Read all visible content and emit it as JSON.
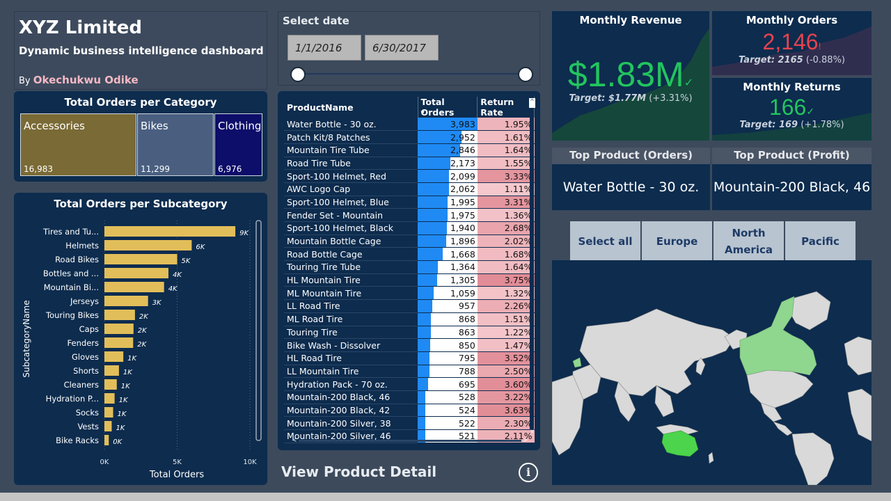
{
  "header": {
    "title": "XYZ Limited",
    "subtitle": "Dynamic business intelligence dashboard",
    "by_label": "By",
    "author": "Okechukwu Odike"
  },
  "date_slicer": {
    "label": "Select date",
    "start": "1/1/2016",
    "end": "6/30/2017"
  },
  "category_panel": {
    "title": "Total Orders per Category",
    "tiles": [
      {
        "name": "Accessories",
        "value": "16,983",
        "color": "#7a6a35"
      },
      {
        "name": "Bikes",
        "value": "11,299",
        "color": "#4a5f80"
      },
      {
        "name": "Clothing",
        "value": "6,976",
        "color": "#0d0d6a"
      }
    ]
  },
  "chart_data": {
    "type": "bar",
    "title": "Total Orders per Subcategory",
    "xlabel": "Total Orders",
    "ylabel": "SubcategoryName",
    "xlim": [
      0,
      10000
    ],
    "xticks": [
      "0K",
      "5K",
      "10K"
    ],
    "categories": [
      "Tires and Tu...",
      "Helmets",
      "Road Bikes",
      "Bottles and ...",
      "Mountain Bi...",
      "Jerseys",
      "Touring Bikes",
      "Caps",
      "Fenders",
      "Gloves",
      "Shorts",
      "Cleaners",
      "Hydration P...",
      "Socks",
      "Vests",
      "Bike Racks"
    ],
    "values": [
      9000,
      6000,
      5000,
      4400,
      4100,
      3000,
      2100,
      2000,
      1975,
      1300,
      1000,
      850,
      700,
      600,
      500,
      300
    ],
    "data_labels": [
      "9K",
      "6K",
      "5K",
      "4K",
      "4K",
      "3K",
      "2K",
      "2K",
      "2K",
      "1K",
      "1K",
      "1K",
      "1K",
      "1K",
      "1K",
      "0K"
    ],
    "bar_color": "#e2be5a",
    "grid": true
  },
  "product_table": {
    "columns": [
      "ProductName",
      "Total Orders",
      "Return Rate"
    ],
    "max_orders": 3983,
    "rows": [
      {
        "name": "Water Bottle - 30 oz.",
        "orders": 3983,
        "orders_label": "3,983",
        "rate": "1.95%"
      },
      {
        "name": "Patch Kit/8 Patches",
        "orders": 2952,
        "orders_label": "2,952",
        "rate": "1.61%"
      },
      {
        "name": "Mountain Tire Tube",
        "orders": 2846,
        "orders_label": "2,846",
        "rate": "1.64%"
      },
      {
        "name": "Road Tire Tube",
        "orders": 2173,
        "orders_label": "2,173",
        "rate": "1.55%"
      },
      {
        "name": "Sport-100 Helmet, Red",
        "orders": 2099,
        "orders_label": "2,099",
        "rate": "3.33%"
      },
      {
        "name": "AWC Logo Cap",
        "orders": 2062,
        "orders_label": "2,062",
        "rate": "1.11%"
      },
      {
        "name": "Sport-100 Helmet, Blue",
        "orders": 1995,
        "orders_label": "1,995",
        "rate": "3.31%"
      },
      {
        "name": "Fender Set - Mountain",
        "orders": 1975,
        "orders_label": "1,975",
        "rate": "1.36%"
      },
      {
        "name": "Sport-100 Helmet, Black",
        "orders": 1940,
        "orders_label": "1,940",
        "rate": "2.68%"
      },
      {
        "name": "Mountain Bottle Cage",
        "orders": 1896,
        "orders_label": "1,896",
        "rate": "2.02%"
      },
      {
        "name": "Road Bottle Cage",
        "orders": 1668,
        "orders_label": "1,668",
        "rate": "1.68%"
      },
      {
        "name": "Touring Tire Tube",
        "orders": 1364,
        "orders_label": "1,364",
        "rate": "1.64%"
      },
      {
        "name": "HL Mountain Tire",
        "orders": 1305,
        "orders_label": "1,305",
        "rate": "3.75%"
      },
      {
        "name": "ML Mountain Tire",
        "orders": 1059,
        "orders_label": "1,059",
        "rate": "1.32%"
      },
      {
        "name": "LL Road Tire",
        "orders": 957,
        "orders_label": "957",
        "rate": "2.26%"
      },
      {
        "name": "ML Road Tire",
        "orders": 868,
        "orders_label": "868",
        "rate": "1.51%"
      },
      {
        "name": "Touring Tire",
        "orders": 863,
        "orders_label": "863",
        "rate": "1.22%"
      },
      {
        "name": "Bike Wash - Dissolver",
        "orders": 850,
        "orders_label": "850",
        "rate": "1.47%"
      },
      {
        "name": "HL Road Tire",
        "orders": 795,
        "orders_label": "795",
        "rate": "3.52%"
      },
      {
        "name": "LL Mountain Tire",
        "orders": 788,
        "orders_label": "788",
        "rate": "2.50%"
      },
      {
        "name": "Hydration Pack - 70 oz.",
        "orders": 695,
        "orders_label": "695",
        "rate": "3.60%"
      },
      {
        "name": "Mountain-200 Black, 46",
        "orders": 528,
        "orders_label": "528",
        "rate": "3.22%"
      },
      {
        "name": "Mountain-200 Black, 42",
        "orders": 524,
        "orders_label": "524",
        "rate": "3.63%"
      },
      {
        "name": "Mountain-200 Silver, 38",
        "orders": 522,
        "orders_label": "522",
        "rate": "2.30%"
      },
      {
        "name": "Mountain-200 Silver, 46",
        "orders": 521,
        "orders_label": "521",
        "rate": "2.11%"
      }
    ]
  },
  "view_detail_label": "View Product Detail",
  "info_glyph": "i",
  "kpis": {
    "revenue": {
      "title": "Monthly Revenue",
      "value": "$1.83M",
      "target_label": "Target: $1.77M",
      "delta": "(+3.31%)",
      "color": "#22c55e"
    },
    "orders": {
      "title": "Monthly Orders",
      "value": "2,146",
      "target_label": "Target: 2165",
      "delta": "(-0.88%)",
      "color": "#e8424e"
    },
    "returns": {
      "title": "Monthly Returns",
      "value": "166",
      "target_label": "Target: 169",
      "delta": "(+1.78%)",
      "color": "#22c55e"
    }
  },
  "top_products": {
    "orders_head": "Top Product (Orders)",
    "orders_value": "Water Bottle - 30 oz.",
    "profit_head": "Top Product (Profit)",
    "profit_value": "Mountain-200 Black, 46"
  },
  "regions": [
    "Select all",
    "Europe",
    "North America",
    "Pacific"
  ],
  "map": {
    "highlight_color": "#8fd68f",
    "pacific_color": "#4cd44c",
    "land_color": "#d9d9d9"
  }
}
